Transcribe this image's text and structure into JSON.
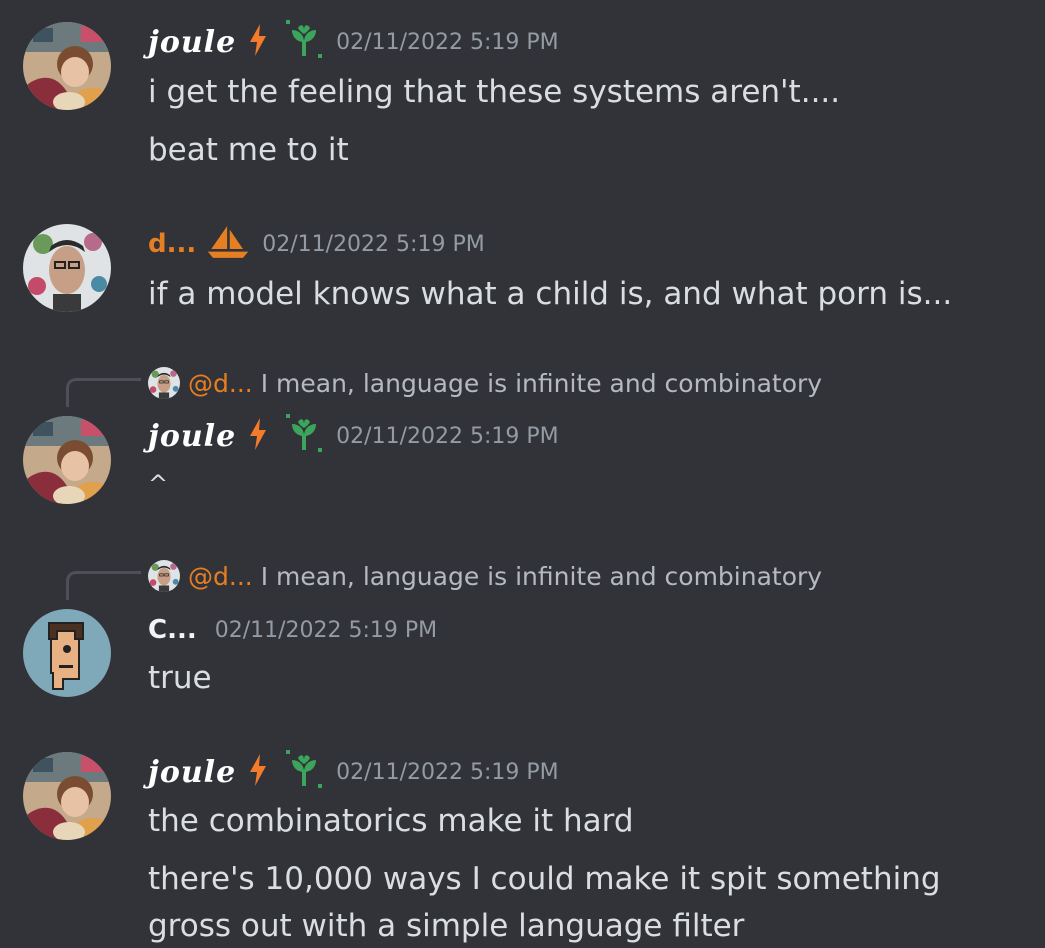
{
  "messages": [
    {
      "author": "joule",
      "timestamp": "02/11/2022 5:19 PM",
      "lines": [
        "i get the feeling that these systems aren't....",
        "beat me to it"
      ]
    },
    {
      "author": "d...",
      "timestamp": "02/11/2022 5:19 PM",
      "lines": [
        "if a model knows what a child is, and what porn is..."
      ]
    },
    {
      "reply": {
        "mention": "@d...",
        "text": "I mean, language is infinite and combinatory"
      },
      "author": "joule",
      "timestamp": "02/11/2022 5:19 PM",
      "lines": [
        "^"
      ]
    },
    {
      "reply": {
        "mention": "@d...",
        "text": "I mean, language is infinite and combinatory"
      },
      "author": "C...",
      "timestamp": "02/11/2022 5:19 PM",
      "lines": [
        "true"
      ]
    },
    {
      "author": "joule",
      "timestamp": "02/11/2022 5:19 PM",
      "lines": [
        "the combinatorics make it hard",
        "there's 10,000 ways I could make it spit something",
        "gross out with a simple language filter"
      ]
    }
  ],
  "colors": {
    "background": "#313338",
    "text": "#dbdee1",
    "timestamp": "#949ba4",
    "orange_name": "#e67e22",
    "badge_green": "#3ba55c",
    "lightning": "#f47b2a"
  },
  "icons": [
    "lightning-icon",
    "sprout-badge-icon",
    "sailboat-icon"
  ]
}
